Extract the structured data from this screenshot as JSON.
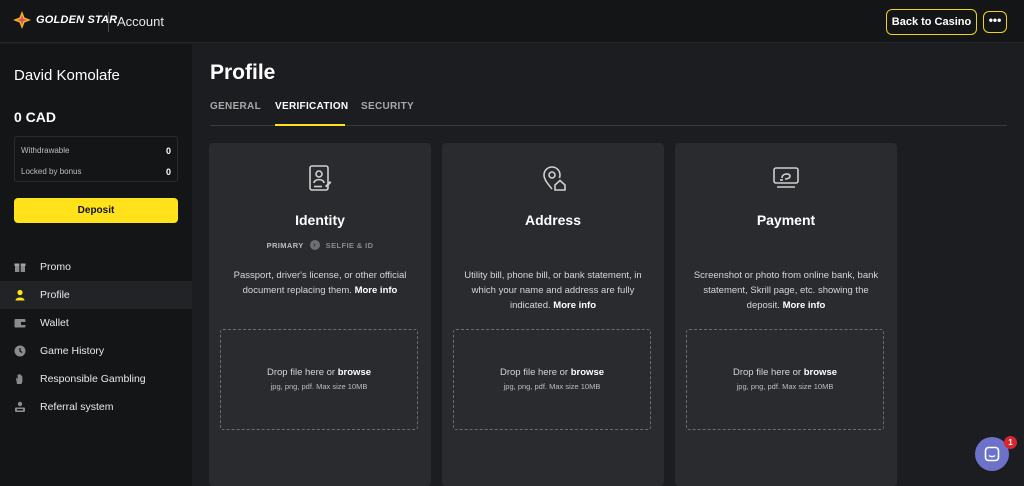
{
  "header": {
    "logo_text": "GOLDEN STAR",
    "title": "Account",
    "back_label": "Back to Casino",
    "more_label": "•••"
  },
  "sidebar": {
    "user_name": "David Komolafe",
    "balance": "0 CAD",
    "withdrawable_label": "Withdrawable",
    "withdrawable_value": "0",
    "locked_label": "Locked by bonus",
    "locked_value": "0",
    "deposit_label": "Deposit",
    "items": [
      {
        "label": "Promo",
        "icon": "gift-icon",
        "active": false
      },
      {
        "label": "Profile",
        "icon": "user-icon",
        "active": true
      },
      {
        "label": "Wallet",
        "icon": "wallet-icon",
        "active": false
      },
      {
        "label": "Game History",
        "icon": "clock-icon",
        "active": false
      },
      {
        "label": "Responsible Gambling",
        "icon": "hand-icon",
        "active": false
      },
      {
        "label": "Referral system",
        "icon": "referral-icon",
        "active": false
      }
    ]
  },
  "main": {
    "title": "Profile",
    "tabs": [
      {
        "label": "GENERAL",
        "active": false
      },
      {
        "label": "VERIFICATION",
        "active": true
      },
      {
        "label": "SECURITY",
        "active": false
      }
    ],
    "cards": [
      {
        "title": "Identity",
        "icon": "id-document-icon",
        "step_primary": "PRIMARY",
        "step_secondary": "SELFIE & ID",
        "desc": "Passport, driver's license, or other official document replacing them.",
        "more": "More info",
        "drop_text": "Drop file here or",
        "drop_link": "browse",
        "drop_hint": "jpg, png, pdf. Max size 10MB"
      },
      {
        "title": "Address",
        "icon": "location-home-icon",
        "desc": "Utility bill, phone bill, or bank statement, in which your name and address are fully indicated.",
        "more": "More info",
        "drop_text": "Drop file here or",
        "drop_link": "browse",
        "drop_hint": "jpg, png, pdf. Max size 10MB"
      },
      {
        "title": "Payment",
        "icon": "payment-card-icon",
        "desc": "Screenshot or photo from online bank, bank statement, Skrill page, etc. showing the deposit.",
        "more": "More info",
        "drop_text": "Drop file here or",
        "drop_link": "browse",
        "drop_hint": "jpg, png, pdf. Max size 10MB"
      }
    ]
  },
  "chat": {
    "badge": "1"
  },
  "colors": {
    "accent": "#ffe21a",
    "background": "#1c1d20",
    "card": "#2a2b2f",
    "chat": "#6c72c9",
    "badge": "#d8262e"
  }
}
